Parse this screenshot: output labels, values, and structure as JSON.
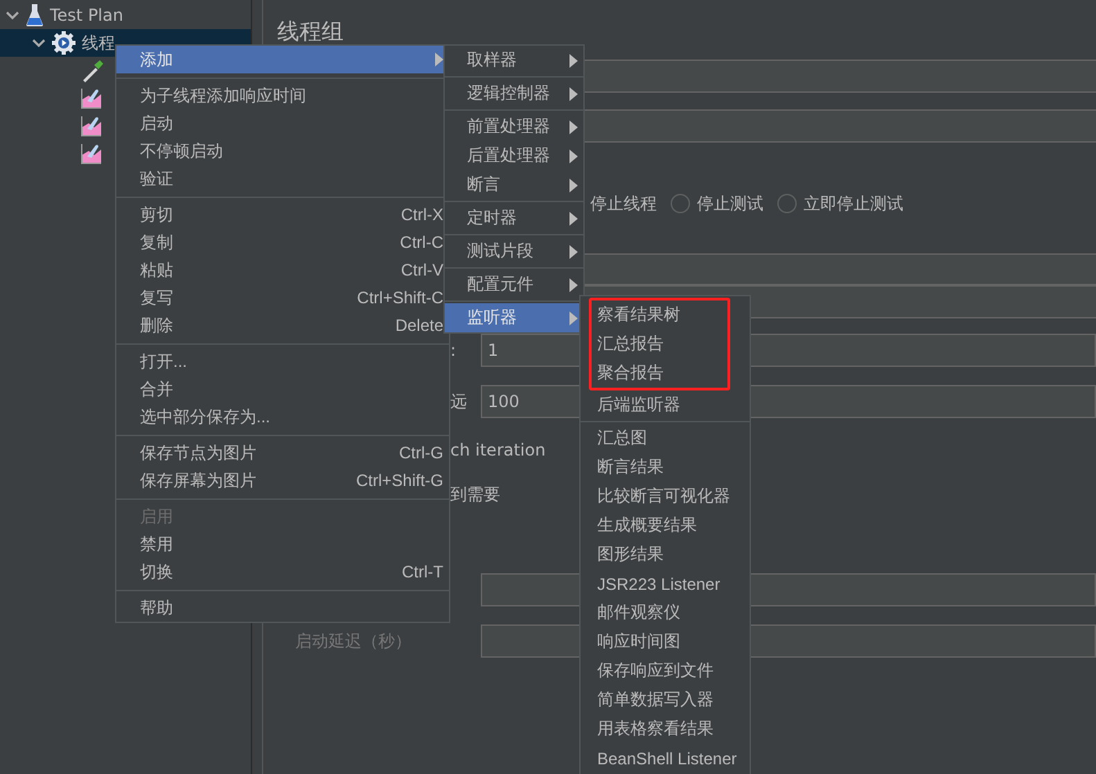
{
  "tree": {
    "items": [
      {
        "label": "Test Plan",
        "expanded": true,
        "selected": false,
        "children": [
          {
            "label": "线程",
            "expanded": true,
            "selected": true,
            "children": [
              {
                "kind": "sampler"
              },
              {
                "kind": "listener"
              },
              {
                "kind": "listener"
              },
              {
                "kind": "listener"
              }
            ]
          }
        ]
      }
    ]
  },
  "panel": {
    "title": "线程组",
    "options": [
      {
        "label": "停止线程"
      },
      {
        "label": "停止测试",
        "selected": false
      },
      {
        "label": "立即停止测试",
        "selected": false
      }
    ],
    "fields": [
      {
        "label": ":",
        "value": "1"
      },
      {
        "label": "远",
        "value": "100"
      }
    ],
    "checks": [
      "ch iteration",
      "到需要"
    ],
    "delay_label": "启动延迟（秒）"
  },
  "context_menu": {
    "sections": [
      {
        "items": [
          {
            "label": "添加",
            "submenu": true,
            "selected": true,
            "disabled": false
          }
        ]
      },
      {
        "divider_before": true,
        "items": [
          {
            "label": "为子线程添加响应时间",
            "selected": false,
            "disabled": false
          },
          {
            "label": "启动",
            "selected": false,
            "disabled": false
          },
          {
            "label": "不停顿启动",
            "selected": false,
            "disabled": false
          },
          {
            "label": "验证",
            "selected": false,
            "disabled": false
          }
        ]
      },
      {
        "divider_before": true,
        "items": [
          {
            "label": "剪切",
            "shortcut": "Ctrl-X",
            "selected": false,
            "disabled": false
          },
          {
            "label": "复制",
            "shortcut": "Ctrl-C",
            "selected": false,
            "disabled": false
          },
          {
            "label": "粘贴",
            "shortcut": "Ctrl-V",
            "selected": false,
            "disabled": false
          },
          {
            "label": "复写",
            "shortcut": "Ctrl+Shift-C",
            "selected": false,
            "disabled": false
          },
          {
            "label": "删除",
            "shortcut": "Delete",
            "selected": false,
            "disabled": false
          }
        ]
      },
      {
        "divider_before": true,
        "items": [
          {
            "label": "打开...",
            "selected": false,
            "disabled": false
          },
          {
            "label": "合并",
            "selected": false,
            "disabled": false
          },
          {
            "label": "选中部分保存为...",
            "selected": false,
            "disabled": false
          }
        ]
      },
      {
        "divider_before": true,
        "items": [
          {
            "label": "保存节点为图片",
            "shortcut": "Ctrl-G",
            "selected": false,
            "disabled": false
          },
          {
            "label": "保存屏幕为图片",
            "shortcut": "Ctrl+Shift-G",
            "selected": false,
            "disabled": false
          }
        ]
      },
      {
        "divider_before": true,
        "items": [
          {
            "label": "启用",
            "selected": false,
            "disabled": true
          },
          {
            "label": "禁用",
            "selected": false,
            "disabled": false
          },
          {
            "label": "切换",
            "shortcut": "Ctrl-T",
            "selected": false,
            "disabled": false
          }
        ]
      },
      {
        "divider_before": true,
        "items": [
          {
            "label": "帮助",
            "selected": false,
            "disabled": false
          }
        ]
      }
    ]
  },
  "add_menu": {
    "sections": [
      {
        "items": [
          {
            "label": "取样器",
            "submenu": true,
            "selected": false
          }
        ]
      },
      {
        "divider_before": true,
        "items": [
          {
            "label": "逻辑控制器",
            "submenu": true,
            "selected": false
          }
        ]
      },
      {
        "divider_before": true,
        "items": [
          {
            "label": "前置处理器",
            "submenu": true,
            "selected": false
          },
          {
            "label": "后置处理器",
            "submenu": true,
            "selected": false
          },
          {
            "label": "断言",
            "submenu": true,
            "selected": false
          }
        ]
      },
      {
        "divider_before": true,
        "items": [
          {
            "label": "定时器",
            "submenu": true,
            "selected": false
          }
        ]
      },
      {
        "divider_before": true,
        "items": [
          {
            "label": "测试片段",
            "submenu": true,
            "selected": false
          }
        ]
      },
      {
        "divider_before": true,
        "items": [
          {
            "label": "配置元件",
            "submenu": true,
            "selected": false
          }
        ]
      },
      {
        "divider_before": true,
        "items": [
          {
            "label": "监听器",
            "submenu": true,
            "selected": true
          }
        ]
      }
    ]
  },
  "listener_menu": {
    "sections": [
      {
        "highlighted": true,
        "items": [
          {
            "label": "察看结果树"
          },
          {
            "label": "汇总报告"
          },
          {
            "label": "聚合报告"
          }
        ]
      },
      {
        "highlighted": false,
        "items": [
          {
            "label": "后端监听器"
          }
        ]
      },
      {
        "divider_before": true,
        "highlighted": false,
        "items": [
          {
            "label": "汇总图"
          },
          {
            "label": "断言结果"
          },
          {
            "label": "比较断言可视化器"
          },
          {
            "label": "生成概要结果"
          },
          {
            "label": "图形结果"
          },
          {
            "label": "JSR223 Listener"
          },
          {
            "label": "邮件观察仪"
          },
          {
            "label": "响应时间图"
          },
          {
            "label": "保存响应到文件"
          },
          {
            "label": "简单数据写入器"
          },
          {
            "label": "用表格察看结果"
          },
          {
            "label": "BeanShell Listener"
          }
        ]
      }
    ]
  }
}
